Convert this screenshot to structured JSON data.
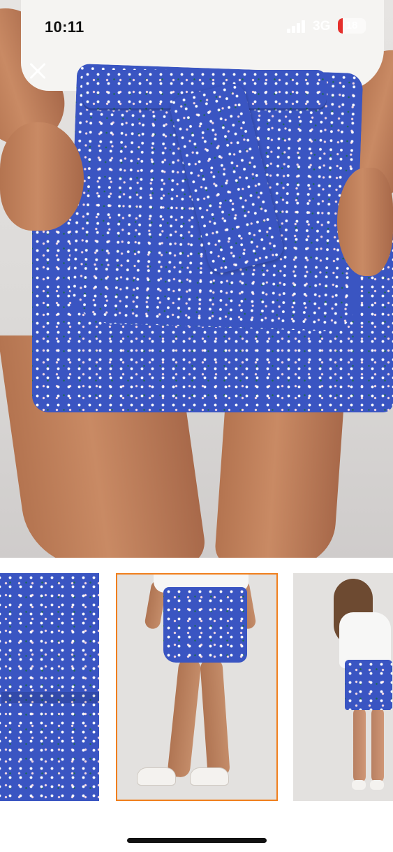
{
  "status_bar": {
    "time": "10:11",
    "network": "3G",
    "battery_level": "18",
    "battery_fraction": 0.18,
    "battery_color": "#e5302c",
    "signal_icon": "cellular-signal-icon"
  },
  "viewer": {
    "close_icon": "close-icon",
    "main_image": "floral-print-skort-front-closeup",
    "selected_thumbnail_index": 1,
    "selected_border_color": "#f07f1d",
    "print_color": "#3a55c2"
  },
  "thumbnails": [
    {
      "image": "fabric-tie-detail-closeup"
    },
    {
      "image": "front-full-body-with-sneakers"
    },
    {
      "image": "back-view-full-body"
    }
  ]
}
